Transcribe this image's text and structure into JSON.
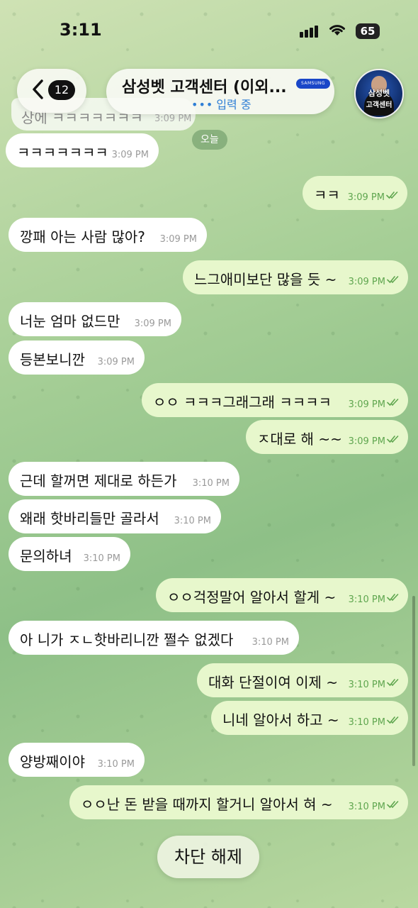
{
  "status_bar": {
    "time": "3:11",
    "battery": "65"
  },
  "header": {
    "back_count": "12",
    "title": "삼성벳 고객센터 (이외...",
    "badge": "SAMSUNG",
    "typing_dots": "•••",
    "typing_text": "입력 중",
    "avatar_line1": "삼성벳",
    "avatar_line2": "고객센터"
  },
  "partial_message": {
    "text": "상에 ㅋㅋㅋㅋㅋㅋㅋ",
    "time": "3:09 PM"
  },
  "date_chip": "오늘",
  "messages": [
    {
      "dir": "in",
      "text": "ㅋㅋㅋㅋㅋㅋㅋ",
      "time": "3:09 PM"
    },
    {
      "dir": "out",
      "text": "ㅋㅋ",
      "time": "3:09 PM"
    },
    {
      "dir": "in",
      "text": "깡패 아는 사람 많아?",
      "time": "3:09 PM"
    },
    {
      "dir": "out",
      "text": "느그애미보단 많을 듯 ~",
      "time": "3:09 PM"
    },
    {
      "dir": "in",
      "text": "너눈 엄마 없드만",
      "time": "3:09 PM"
    },
    {
      "dir": "in",
      "text": "등본보니깐",
      "time": "3:09 PM"
    },
    {
      "dir": "out",
      "text": "ㅇㅇ ㅋㅋㅋ그래그래 ㅋㅋㅋㅋ",
      "time": "3:09 PM"
    },
    {
      "dir": "out",
      "text": "ㅈ대로 해 ~~",
      "time": "3:09 PM"
    },
    {
      "dir": "in",
      "text": "근데 할꺼면 제대로 하든가",
      "time": "3:10 PM"
    },
    {
      "dir": "in",
      "text": "왜래 핫바리들만 골라서",
      "time": "3:10 PM"
    },
    {
      "dir": "in",
      "text": "문의하녀",
      "time": "3:10 PM"
    },
    {
      "dir": "out",
      "text": "ㅇㅇ걱정말어 알아서 할게 ~",
      "time": "3:10 PM"
    },
    {
      "dir": "in",
      "text": "아 니가 ㅈㄴ핫바리니깐 쩔수 없겠다",
      "time": "3:10 PM"
    },
    {
      "dir": "out",
      "text": "대화 단절이여 이제 ~",
      "time": "3:10 PM"
    },
    {
      "dir": "out",
      "text": "니네 알아서 하고 ~",
      "time": "3:10 PM"
    },
    {
      "dir": "in",
      "text": "양방째이야",
      "time": "3:10 PM"
    },
    {
      "dir": "out",
      "text": "ㅇㅇ난 돈 받을 때까지 할거니 알아서 혀 ~",
      "time": "3:10 PM"
    }
  ],
  "unblock_label": "차단 해제",
  "colors": {
    "incoming": "#ffffff",
    "outgoing": "#e7f7cc",
    "accent": "#2f7fd6",
    "check": "#5fa64f"
  }
}
